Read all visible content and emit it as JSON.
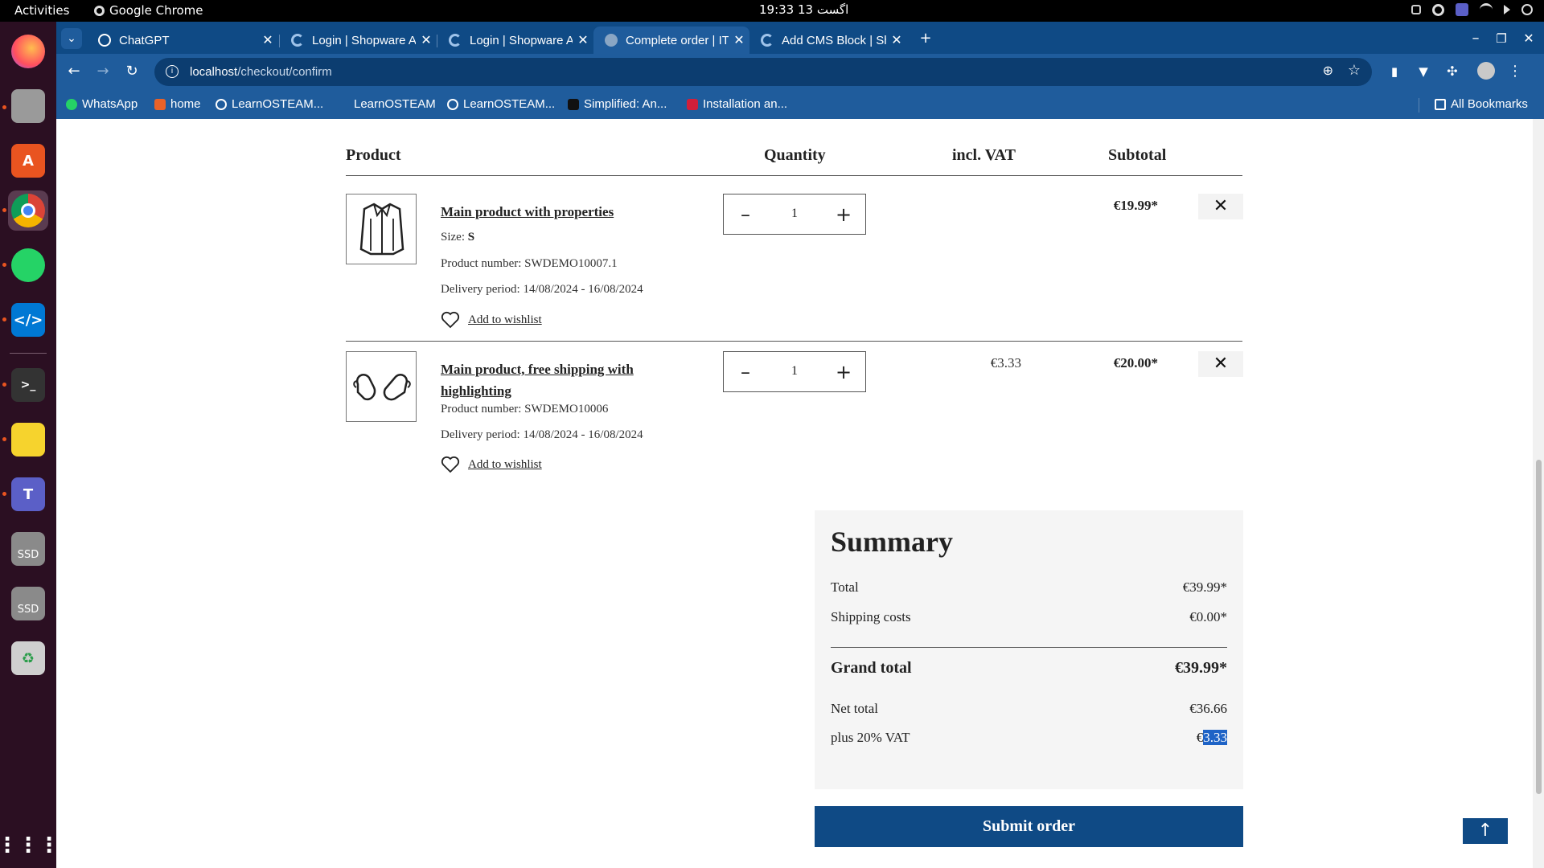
{
  "system": {
    "activities": "Activities",
    "app_name": "Google Chrome",
    "clock": "اگست 13  19:33"
  },
  "dock": {
    "items": [
      "firefox-icon",
      "files-icon",
      "app-center-icon",
      "chrome-icon",
      "whatsapp-icon",
      "vscode-icon",
      "terminal-icon",
      "notes-icon",
      "teams-icon",
      "ssd-drive-icon",
      "ssd-drive-icon",
      "trash-icon",
      "app-grid-icon"
    ],
    "ssd_label": "SSD"
  },
  "browser": {
    "tabs": [
      {
        "label": "ChatGPT",
        "active": false
      },
      {
        "label": "Login | Shopware Admin",
        "active": false
      },
      {
        "label": "Login | Shopware Admin",
        "active": false
      },
      {
        "label": "Complete order | ITS",
        "active": true
      },
      {
        "label": "Add CMS Block | Shopware",
        "active": false
      }
    ],
    "url_host": "localhost",
    "url_path": "/checkout/confirm",
    "bookmarks": [
      "WhatsApp",
      "home",
      "LearnOSTEAM...",
      "LearnOSTEAM",
      "LearnOSTEAM...",
      "Simplified: An...",
      "Installation an..."
    ],
    "all_bookmarks": "All Bookmarks"
  },
  "cart": {
    "headers": {
      "product": "Product",
      "quantity": "Quantity",
      "vat": "incl. VAT",
      "subtotal": "Subtotal"
    },
    "items": [
      {
        "name": "Main product with properties",
        "size_label": "Size:",
        "size_value": "S",
        "product_number": "Product number: SWDEMO10007.1",
        "delivery": "Delivery period: 14/08/2024 - 16/08/2024",
        "wishlist": "Add to wishlist",
        "quantity": "1",
        "vat": "",
        "subtotal": "€19.99*"
      },
      {
        "name_line1": "Main product, free shipping with",
        "name_line2": "highlighting",
        "product_number": "Product number: SWDEMO10006",
        "delivery": "Delivery period: 14/08/2024 - 16/08/2024",
        "wishlist": "Add to wishlist",
        "quantity": "1",
        "vat": "€3.33",
        "subtotal": "€20.00*"
      }
    ]
  },
  "summary": {
    "title": "Summary",
    "total_label": "Total",
    "total_value": "€39.99*",
    "shipping_label": "Shipping costs",
    "shipping_value": "€0.00*",
    "grand_label": "Grand total",
    "grand_value": "€39.99*",
    "net_label": "Net total",
    "net_value": "€36.66",
    "vat_label": "plus 20% VAT",
    "vat_currency": "€",
    "vat_amount_selected": "3.33"
  },
  "actions": {
    "submit": "Submit order",
    "to_top": "↑"
  },
  "colors": {
    "brand": "#0f4a85",
    "selection": "#1e63c6"
  }
}
